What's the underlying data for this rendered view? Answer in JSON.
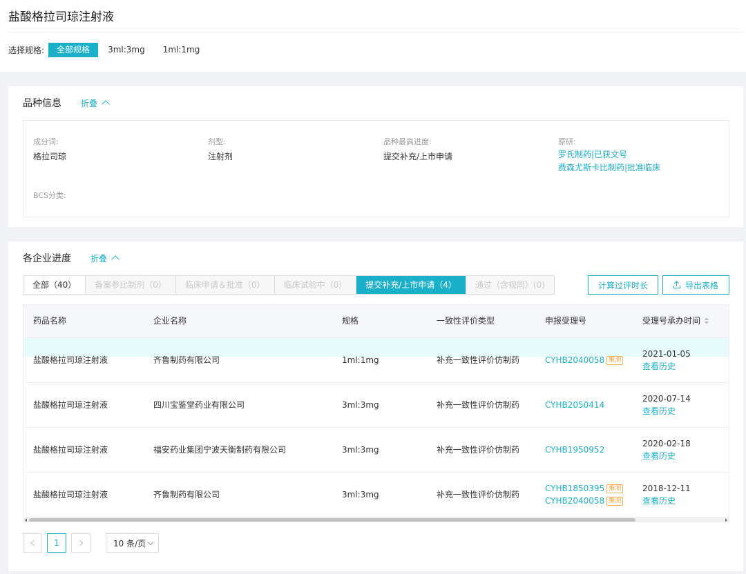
{
  "page_title": "盐酸格拉司琼注射液",
  "spec": {
    "label": "选择规格:",
    "options": [
      {
        "label": "全部规格",
        "active": true
      },
      {
        "label": "3ml:3mg",
        "active": false
      },
      {
        "label": "1ml:1mg",
        "active": false
      }
    ]
  },
  "variety": {
    "title": "品种信息",
    "fold_label": "折叠",
    "ingredient_label": "成分词:",
    "ingredient_value": "格拉司琼",
    "dosage_label": "剂型:",
    "dosage_value": "注射剂",
    "progress_label": "品种最高进度:",
    "progress_value": "提交补充/上市申请",
    "original_label": "原研:",
    "original_links": [
      "罗氏制药|已获文号",
      "费森尤斯卡比制药|批准临床"
    ],
    "bcs_label": "BCS分类:"
  },
  "company": {
    "title": "各企业进度",
    "fold_label": "折叠",
    "tabs": [
      "全部（40）",
      "备案参比制剂（0）",
      "临床申请＆批准（0）",
      "临床试验中（0）",
      "提交补充/上市申请（4）",
      "通过（含视同）(0)"
    ],
    "active_tab": 4,
    "calc_button": "计算过评时长",
    "export_button": "导出表格",
    "columns": [
      "药品名称",
      "企业名称",
      "规格",
      "一致性评价类型",
      "申报受理号",
      "受理号承办时间"
    ],
    "rows": [
      {
        "drug": "盐酸格拉司琼注射液",
        "company": "齐鲁制药有限公司",
        "spec": "1ml:1mg",
        "type": "补充一致性评价仿制药",
        "refs": [
          {
            "no": "CYHB2040058",
            "tag": "推测"
          }
        ],
        "date": "2021-01-05",
        "history": "查看历史"
      },
      {
        "drug": "盐酸格拉司琼注射液",
        "company": "四川宝鉴堂药业有限公司",
        "spec": "3ml:3mg",
        "type": "补充一致性评价仿制药",
        "refs": [
          {
            "no": "CYHB2050414",
            "tag": ""
          }
        ],
        "date": "2020-07-14",
        "history": "查看历史"
      },
      {
        "drug": "盐酸格拉司琼注射液",
        "company": "福安药业集团宁波天衡制药有限公司",
        "spec": "3ml:3mg",
        "type": "补充一致性评价仿制药",
        "refs": [
          {
            "no": "CYHB1950952",
            "tag": ""
          }
        ],
        "date": "2020-02-18",
        "history": "查看历史"
      },
      {
        "drug": "盐酸格拉司琼注射液",
        "company": "齐鲁制药有限公司",
        "spec": "3ml:3mg",
        "type": "补充一致性评价仿制药",
        "refs": [
          {
            "no": "CYHB1850395",
            "tag": "推测"
          },
          {
            "no": "CYHB2040058",
            "tag": "推测"
          }
        ],
        "date": "2018-12-11",
        "history": "查看历史"
      }
    ]
  },
  "pagination": {
    "current_page": "1",
    "page_size": "10 条/页"
  },
  "colors": {
    "accent": "#1ab0c9",
    "tag": "#f5a13a"
  }
}
